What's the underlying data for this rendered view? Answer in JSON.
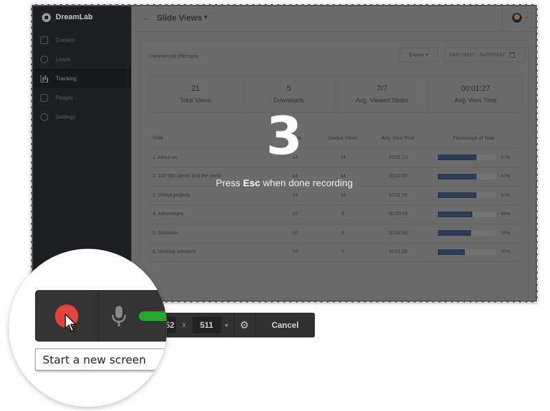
{
  "app": {
    "brand": "DreamLab",
    "sidebar": {
      "items": [
        {
          "label": "Content",
          "icon": "file-icon",
          "active": false
        },
        {
          "label": "Leads",
          "icon": "user-circle-icon",
          "active": false
        },
        {
          "label": "Tracking",
          "icon": "chart-icon",
          "active": true
        },
        {
          "label": "People",
          "icon": "people-icon",
          "active": false
        },
        {
          "label": "Settings",
          "icon": "settings-icon",
          "active": false
        }
      ]
    },
    "header": {
      "back_icon": "←",
      "title": "Slide Views",
      "title_caret": "▾",
      "user_caret": "▾"
    },
    "toolbar": {
      "file_name": "Commercial offer.pptx",
      "export_label": "Export ▾",
      "date_range": "24/07/2017 - 31/07/2017"
    },
    "stats": [
      {
        "value": "21",
        "label": "Total Views"
      },
      {
        "value": "5",
        "label": "Downloads"
      },
      {
        "value": "7/7",
        "label": "Avg. Viewed Slides"
      },
      {
        "value": "00:01:27",
        "label": "Avg. View Time"
      }
    ],
    "table": {
      "headers": [
        "Slide",
        "Views",
        "Unique Views",
        "Avg. View Time",
        "Percentage of Total"
      ],
      "rows": [
        {
          "slide": "1. About us",
          "views": "14",
          "unique": "14",
          "time": "00:01:13",
          "pct": 67,
          "pct_label": "67%"
        },
        {
          "slide": "2. 100 000 clients and the world",
          "views": "14",
          "unique": "14",
          "time": "00:02:00",
          "pct": 67,
          "pct_label": "67%"
        },
        {
          "slide": "3. Global projects",
          "views": "14",
          "unique": "14",
          "time": "00:01:56",
          "pct": 67,
          "pct_label": "67%"
        },
        {
          "slide": "4. Advantages",
          "views": "10",
          "unique": "9",
          "time": "00:00:53",
          "pct": 60,
          "pct_label": "60%"
        },
        {
          "slide": "5. Solutions",
          "views": "10",
          "unique": "8",
          "time": "00:02:50",
          "pct": 57,
          "pct_label": "57%"
        },
        {
          "slide": "6. Desktop solutions",
          "views": "10",
          "unique": "5",
          "time": "00:01:28",
          "pct": 47,
          "pct_label": "47%"
        }
      ]
    }
  },
  "overlay": {
    "countdown": "3",
    "hint_prefix": "Press ",
    "hint_key": "Esc",
    "hint_suffix": " when done recording"
  },
  "recorder": {
    "width": "52",
    "x_label": "x",
    "height": "511",
    "dim_caret": "▾",
    "settings_icon": "⚙",
    "cancel_label": "Cancel",
    "tooltip": "Start a new screen",
    "colors": {
      "record": "#e0443c",
      "mic_on": "#27a62e"
    }
  }
}
